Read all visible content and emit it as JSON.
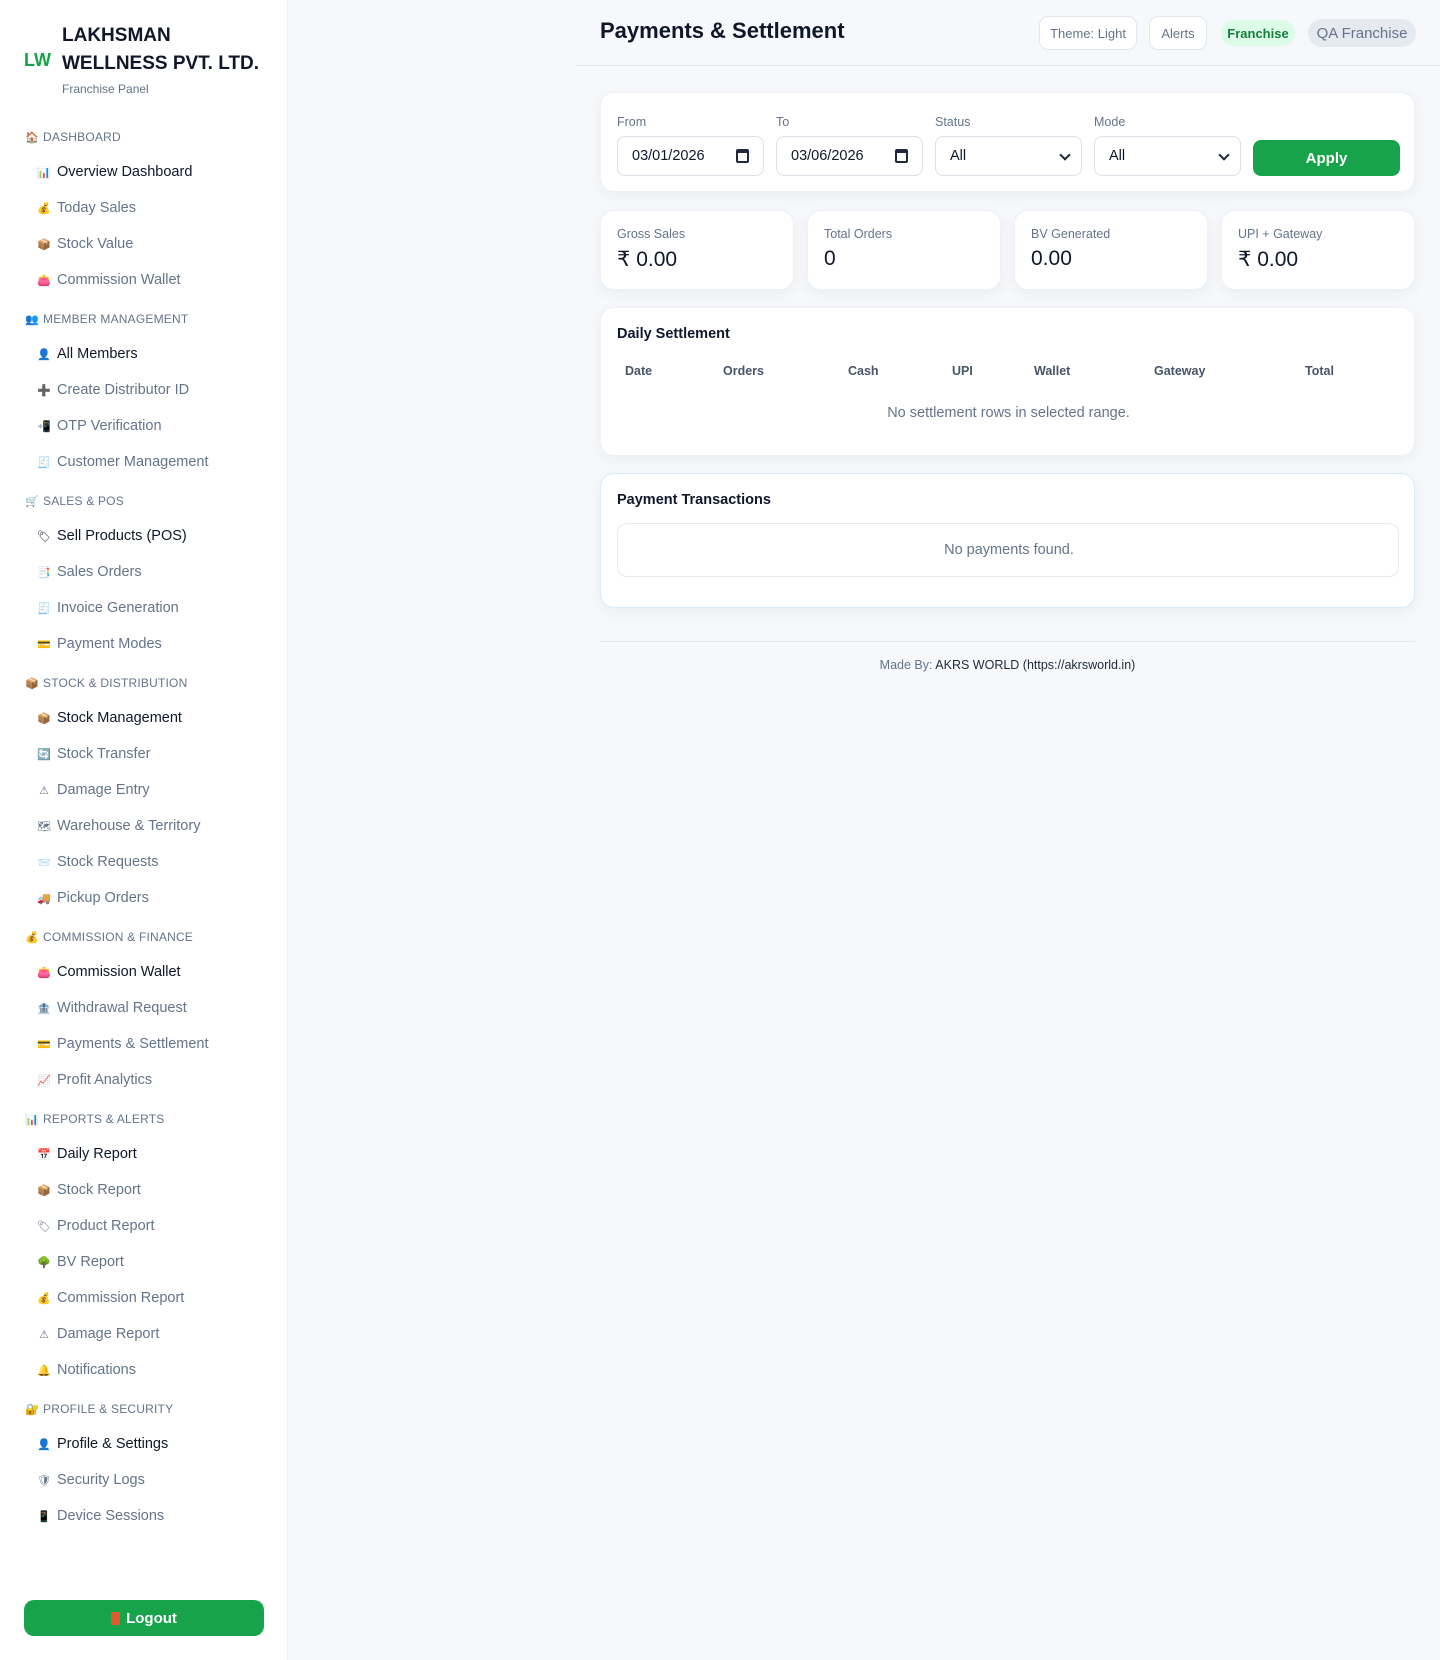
{
  "brand": {
    "mark": "LW",
    "name": "LAKHSMAN WELLNESS PVT. LTD.",
    "subtitle": "Franchise Panel"
  },
  "sidebar": {
    "sections": [
      {
        "title": "DASHBOARD",
        "icon": "house-icon",
        "glyph": "🏠",
        "items": [
          {
            "label": "Overview Dashboard",
            "icon": "bar-chart-icon",
            "glyph": "📊",
            "strong": true
          },
          {
            "label": "Today Sales",
            "icon": "money-bag-icon",
            "glyph": "💰"
          },
          {
            "label": "Stock Value",
            "icon": "package-icon",
            "glyph": "📦"
          },
          {
            "label": "Commission Wallet",
            "icon": "wallet-icon",
            "glyph": "👛"
          }
        ]
      },
      {
        "title": "MEMBER MANAGEMENT",
        "icon": "people-icon",
        "glyph": "👥",
        "items": [
          {
            "label": "All Members",
            "icon": "person-icon",
            "glyph": "👤",
            "strong": true
          },
          {
            "label": "Create Distributor ID",
            "icon": "plus-icon",
            "glyph": "➕"
          },
          {
            "label": "OTP Verification",
            "icon": "phone-icon",
            "glyph": "📲"
          },
          {
            "label": "Customer Management",
            "icon": "receipt-icon",
            "glyph": "🧾"
          }
        ]
      },
      {
        "title": "SALES & POS",
        "icon": "cart-icon",
        "glyph": "🛒",
        "items": [
          {
            "label": "Sell Products (POS)",
            "icon": "tag-icon",
            "glyph": "🏷",
            "strong": true
          },
          {
            "label": "Sales Orders",
            "icon": "document-icon",
            "glyph": "📑"
          },
          {
            "label": "Invoice Generation",
            "icon": "invoice-icon",
            "glyph": "🧾"
          },
          {
            "label": "Payment Modes",
            "icon": "credit-card-icon",
            "glyph": "💳"
          }
        ]
      },
      {
        "title": "STOCK & DISTRIBUTION",
        "icon": "package-icon",
        "glyph": "📦",
        "items": [
          {
            "label": "Stock Management",
            "icon": "package-icon",
            "glyph": "📦",
            "strong": true
          },
          {
            "label": "Stock Transfer",
            "icon": "transfer-icon",
            "glyph": "🔄"
          },
          {
            "label": "Damage Entry",
            "icon": "warning-icon",
            "glyph": "⚠"
          },
          {
            "label": "Warehouse & Territory",
            "icon": "map-icon",
            "glyph": "🗺"
          },
          {
            "label": "Stock Requests",
            "icon": "envelope-icon",
            "glyph": "📨"
          },
          {
            "label": "Pickup Orders",
            "icon": "truck-icon",
            "glyph": "🚚"
          }
        ]
      },
      {
        "title": "COMMISSION & FINANCE",
        "icon": "money-bag-icon",
        "glyph": "💰",
        "items": [
          {
            "label": "Commission Wallet",
            "icon": "wallet-icon",
            "glyph": "👛",
            "strong": true
          },
          {
            "label": "Withdrawal Request",
            "icon": "bank-icon",
            "glyph": "🏦"
          },
          {
            "label": "Payments & Settlement",
            "icon": "credit-card-icon",
            "glyph": "💳"
          },
          {
            "label": "Profit Analytics",
            "icon": "trend-chart-icon",
            "glyph": "📈"
          }
        ]
      },
      {
        "title": "REPORTS & ALERTS",
        "icon": "bar-chart-icon",
        "glyph": "📊",
        "items": [
          {
            "label": "Daily Report",
            "icon": "calendar-icon",
            "glyph": "📅",
            "strong": true
          },
          {
            "label": "Stock Report",
            "icon": "package-icon",
            "glyph": "📦"
          },
          {
            "label": "Product Report",
            "icon": "tag-icon",
            "glyph": "🏷"
          },
          {
            "label": "BV Report",
            "icon": "tree-icon",
            "glyph": "🌳"
          },
          {
            "label": "Commission Report",
            "icon": "money-bag-icon",
            "glyph": "💰"
          },
          {
            "label": "Damage Report",
            "icon": "warning-icon",
            "glyph": "⚠"
          },
          {
            "label": "Notifications",
            "icon": "bell-icon",
            "glyph": "🔔"
          }
        ]
      },
      {
        "title": "PROFILE & SECURITY",
        "icon": "lock-icon",
        "glyph": "🔐",
        "items": [
          {
            "label": "Profile & Settings",
            "icon": "person-icon",
            "glyph": "👤",
            "strong": true
          },
          {
            "label": "Security Logs",
            "icon": "shield-icon",
            "glyph": "🛡"
          },
          {
            "label": "Device Sessions",
            "icon": "device-icon",
            "glyph": "📱"
          }
        ]
      }
    ],
    "logout_label": "Logout"
  },
  "header": {
    "title": "Payments & Settlement",
    "theme_label": "Theme: Light",
    "alerts_label": "Alerts",
    "role_badge": "Franchise",
    "user_badge": "QA Franchise"
  },
  "filters": {
    "from_label": "From",
    "from_value": "03/01/2026",
    "to_label": "To",
    "to_value": "03/06/2026",
    "status_label": "Status",
    "status_value": "All",
    "mode_label": "Mode",
    "mode_value": "All",
    "apply_label": "Apply"
  },
  "stats": [
    {
      "label": "Gross Sales",
      "value": "₹ 0.00"
    },
    {
      "label": "Total Orders",
      "value": "0"
    },
    {
      "label": "BV Generated",
      "value": "0.00"
    },
    {
      "label": "UPI + Gateway",
      "value": "₹ 0.00"
    }
  ],
  "daily_settlement": {
    "title": "Daily Settlement",
    "columns": [
      "Date",
      "Orders",
      "Cash",
      "UPI",
      "Wallet",
      "Gateway",
      "Total"
    ],
    "empty_text": "No settlement rows in selected range."
  },
  "payment_transactions": {
    "title": "Payment Transactions",
    "empty_text": "No payments found."
  },
  "footer": {
    "prefix": "Made By:",
    "credit": "AKRS WORLD (https://akrsworld.in)"
  },
  "colors": {
    "accent": "#16a34a",
    "badge_bg": "#dcfce7",
    "text": "#0f172a",
    "muted": "#64748b"
  }
}
